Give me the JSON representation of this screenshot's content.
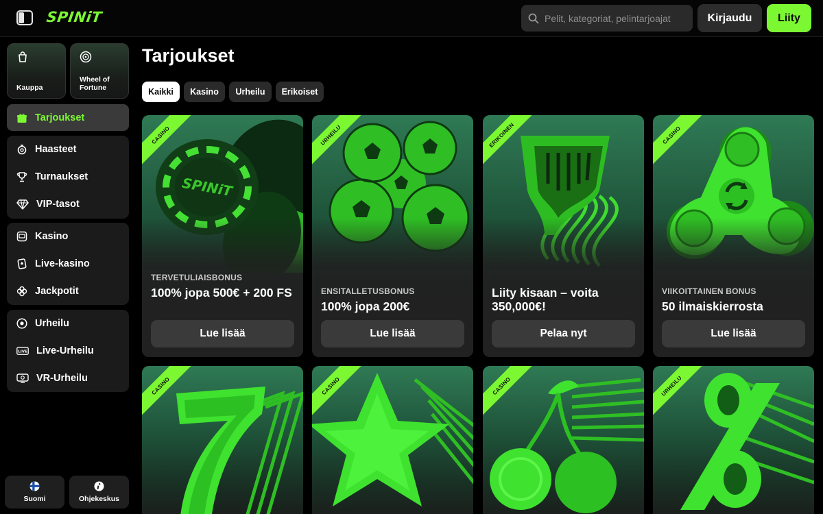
{
  "brand": {
    "name": "SPINiT",
    "accent": "#7cf832"
  },
  "header": {
    "search_placeholder": "Pelit, kategoriat, pelintarjoajat",
    "login_label": "Kirjaudu",
    "join_label": "Liity"
  },
  "sidebar": {
    "tiles": [
      {
        "label": "Kauppa",
        "icon": "shopping-bag-icon"
      },
      {
        "label": "Wheel of Fortune",
        "icon": "wheel-icon"
      }
    ],
    "active_item": {
      "label": "Tarjoukset",
      "icon": "gift-icon"
    },
    "groups": [
      [
        {
          "label": "Haasteet",
          "icon": "challenge-icon"
        },
        {
          "label": "Turnaukset",
          "icon": "trophy-icon"
        },
        {
          "label": "VIP-tasot",
          "icon": "diamond-icon"
        }
      ],
      [
        {
          "label": "Kasino",
          "icon": "slot-machine-icon"
        },
        {
          "label": "Live-kasino",
          "icon": "spade-card-icon"
        },
        {
          "label": "Jackpotit",
          "icon": "clover-icon"
        }
      ],
      [
        {
          "label": "Urheilu",
          "icon": "soccer-ball-icon"
        },
        {
          "label": "Live-Urheilu",
          "icon": "live-badge-icon"
        },
        {
          "label": "VR-Urheilu",
          "icon": "vr-screen-icon"
        }
      ]
    ],
    "footer": [
      {
        "label": "Suomi",
        "icon": "finland-flag-icon"
      },
      {
        "label": "Ohjekeskus",
        "icon": "info-icon"
      }
    ]
  },
  "main": {
    "title": "Tarjoukset",
    "filters": [
      {
        "label": "Kaikki",
        "active": true
      },
      {
        "label": "Kasino",
        "active": false
      },
      {
        "label": "Urheilu",
        "active": false
      },
      {
        "label": "Erikoiset",
        "active": false
      }
    ],
    "cards": [
      {
        "tag": "CASINO",
        "subtitle": "TERVETULIAISBONUS",
        "title": "100% jopa 500€ + 200 FS",
        "cta": "Lue lisää",
        "art": "poker-chips"
      },
      {
        "tag": "URHEILU",
        "subtitle": "ENSITALLETUSBONUS",
        "title": "100% jopa 200€",
        "cta": "Lue lisää",
        "art": "soccer-balls"
      },
      {
        "tag": "ERIKOINEN",
        "subtitle": "",
        "title": "Liity kisaan – voita 350,000€!",
        "cta": "Pelaa nyt",
        "art": "trophy"
      },
      {
        "tag": "CASINO",
        "subtitle": "VIIKOITTAINEN BONUS",
        "title": "50 ilmaiskierrosta",
        "cta": "Lue lisää",
        "art": "fidget-spinner"
      },
      {
        "tag": "CASINO",
        "art": "lucky-seven"
      },
      {
        "tag": "CASINO",
        "art": "star"
      },
      {
        "tag": "CASINO",
        "art": "cherries"
      },
      {
        "tag": "URHEILU",
        "art": "percent"
      }
    ]
  }
}
